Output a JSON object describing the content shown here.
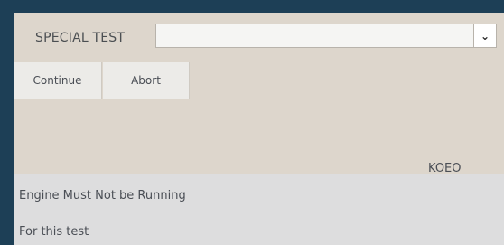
{
  "header": {
    "title": "SPECIAL TEST",
    "dropdown_value": ""
  },
  "buttons": {
    "continue_label": "Continue",
    "abort_label": "Abort"
  },
  "status": {
    "mode": "KOEO"
  },
  "messages": [
    "Engine Must Not be Running",
    "For this test"
  ],
  "icons": {
    "dropdown": "chevron-down-icon"
  }
}
